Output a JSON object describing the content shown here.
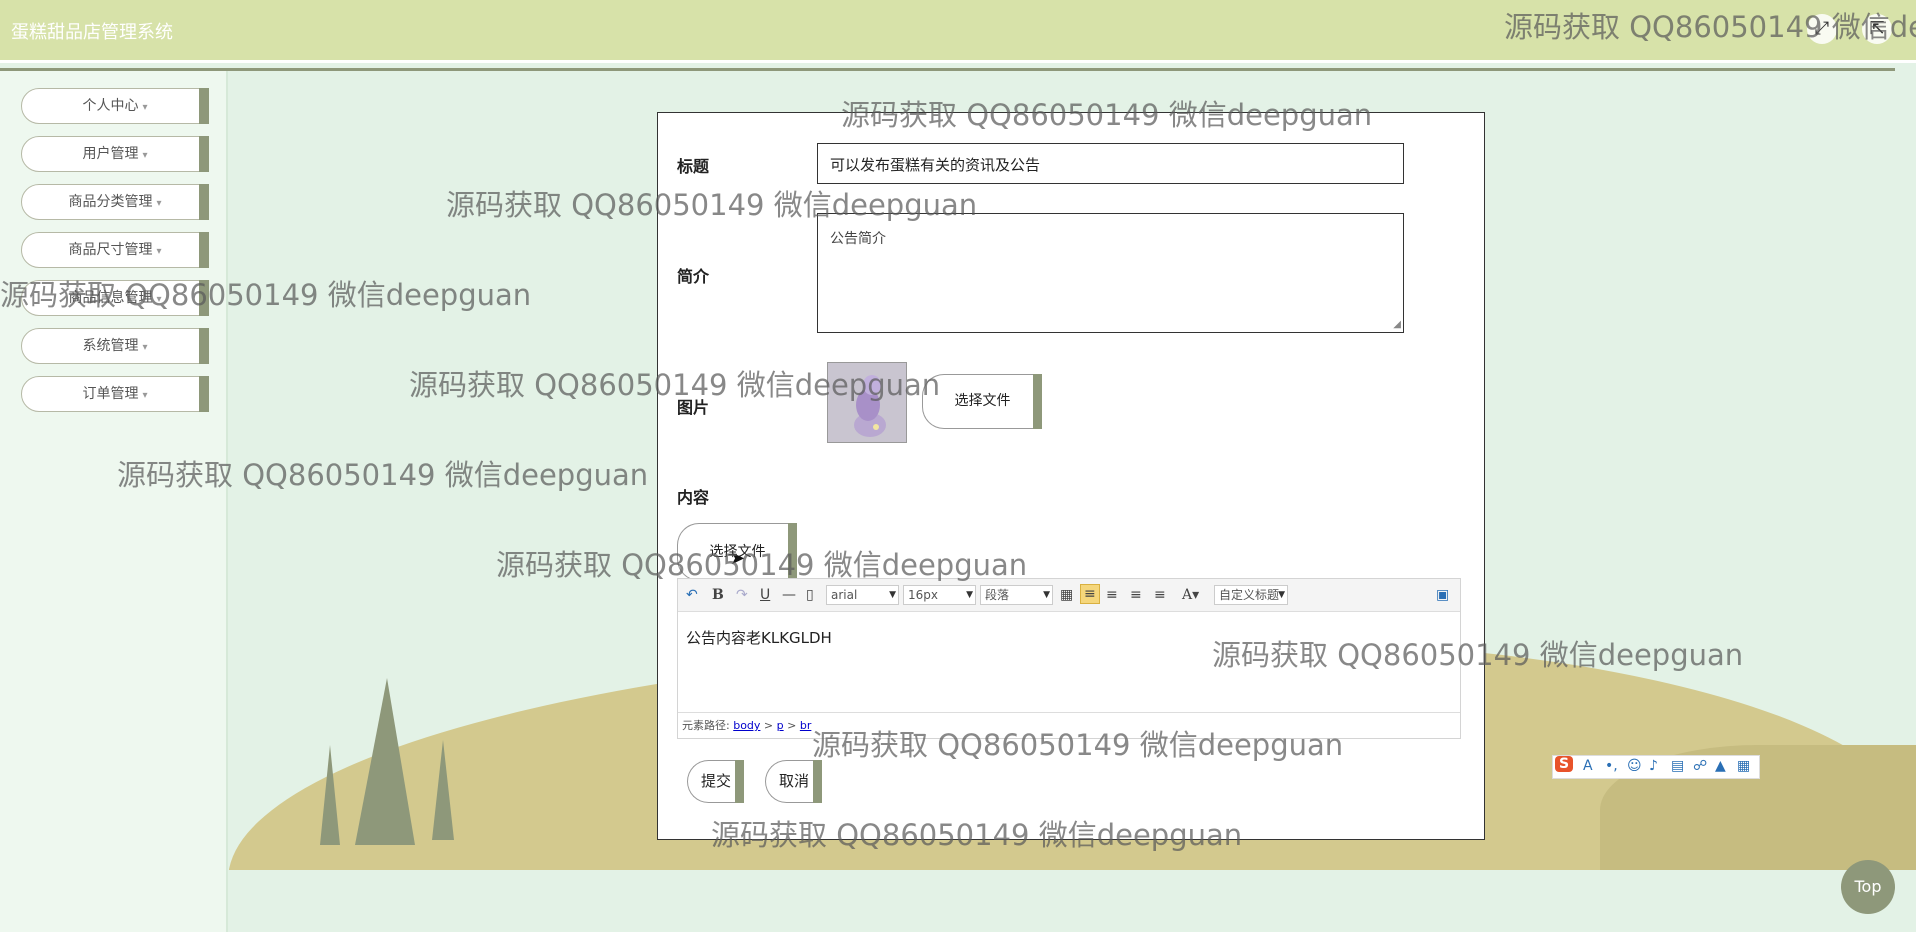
{
  "app": {
    "title": "蛋糕甜品店管理系统"
  },
  "sidebar": {
    "items": [
      {
        "label": "个人中心"
      },
      {
        "label": "用户管理"
      },
      {
        "label": "商品分类管理"
      },
      {
        "label": "商品尺寸管理"
      },
      {
        "label": "商品信息管理"
      },
      {
        "label": "系统管理"
      },
      {
        "label": "订单管理"
      }
    ]
  },
  "form": {
    "title_label": "标题",
    "title_value": "可以发布蛋糕有关的资讯及公告",
    "summary_label": "简介",
    "summary_value": "公告简介",
    "image_label": "图片",
    "choose_file": "选择文件",
    "content_label": "内容",
    "content_choose_file": "选择文件",
    "submit": "提交",
    "cancel": "取消"
  },
  "editor": {
    "font_family": "arial",
    "font_size": "16px",
    "paragraph": "段落",
    "custom_title": "自定义标题",
    "content": "公告内容老KLKGLDH",
    "path_label": "元素路径:",
    "path_items": [
      "body",
      "p",
      "br"
    ]
  },
  "watermark": "源码获取 QQ86050149 微信deepguan",
  "watermark_partial": "源码获取 QQ86050149 微信de",
  "top_button": "Top",
  "colors": {
    "header": "#d7e2a9",
    "accent": "#8e987a",
    "ground": "#d3c98e"
  }
}
